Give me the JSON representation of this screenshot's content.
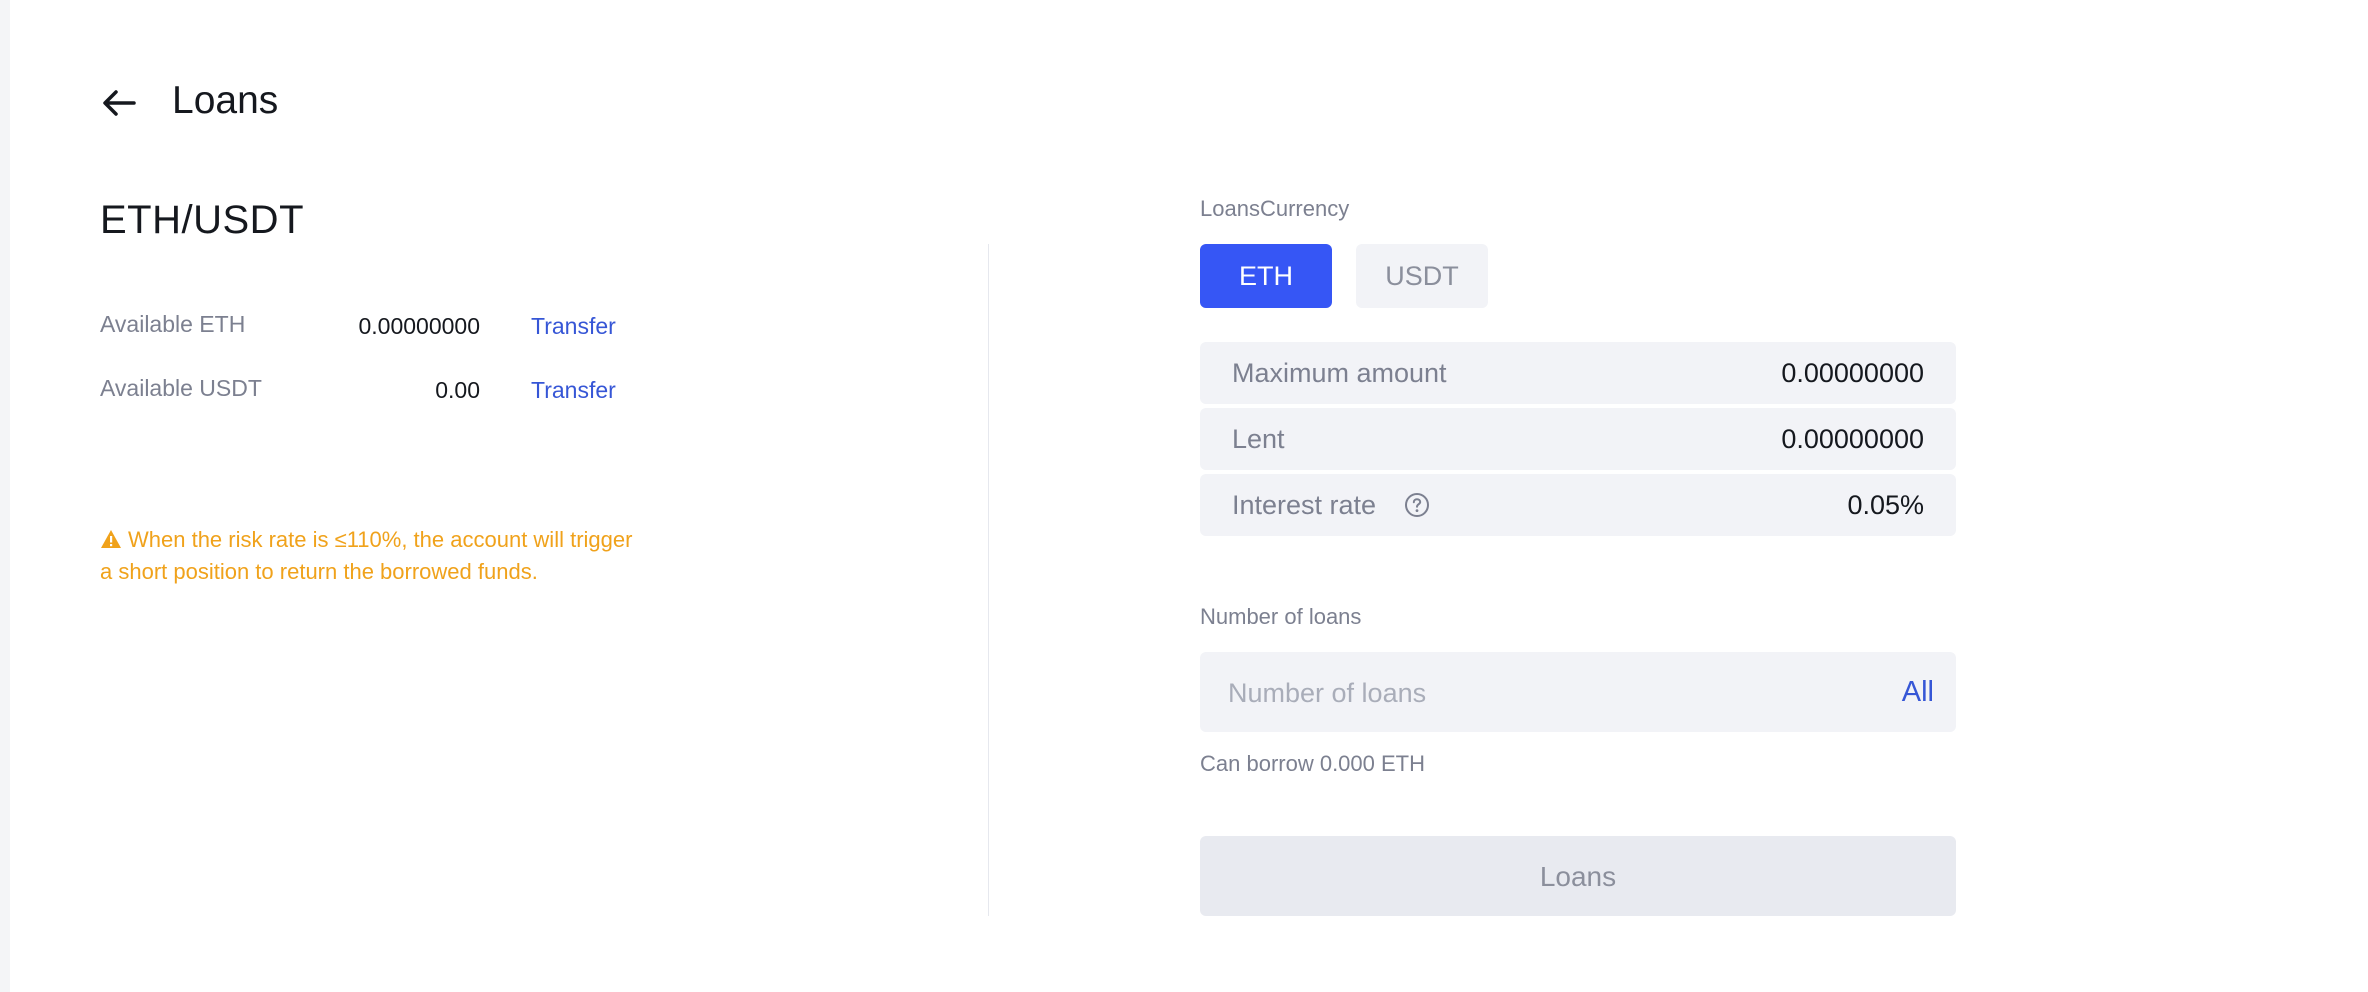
{
  "header": {
    "title": "Loans"
  },
  "pair": "ETH/USDT",
  "assets": [
    {
      "label": "Available ETH",
      "value": "0.00000000",
      "action": "Transfer"
    },
    {
      "label": "Available USDT",
      "value": "0.00",
      "action": "Transfer"
    }
  ],
  "warning": "When the risk rate is ≤110%, the account will trigger a short position to return the borrowed funds.",
  "loan_form": {
    "currency_label": "LoansCurrency",
    "currencies": [
      {
        "label": "ETH",
        "selected": true
      },
      {
        "label": "USDT",
        "selected": false
      }
    ],
    "info": [
      {
        "label": "Maximum amount",
        "value": "0.00000000"
      },
      {
        "label": "Lent",
        "value": "0.00000000"
      },
      {
        "label": "Interest rate",
        "value": "0.05%"
      }
    ],
    "amount_label": "Number of loans",
    "amount_placeholder": "Number of loans",
    "amount_value": "",
    "all_label": "All",
    "can_borrow": "Can borrow 0.000 ETH",
    "submit_label": "Loans"
  },
  "colors": {
    "accent": "#3656f5",
    "link": "#3656d6",
    "warning": "#f0a21b"
  },
  "icons": {
    "back": "arrow-left-icon",
    "help": "question-circle-icon",
    "warning": "warning-triangle-icon"
  }
}
